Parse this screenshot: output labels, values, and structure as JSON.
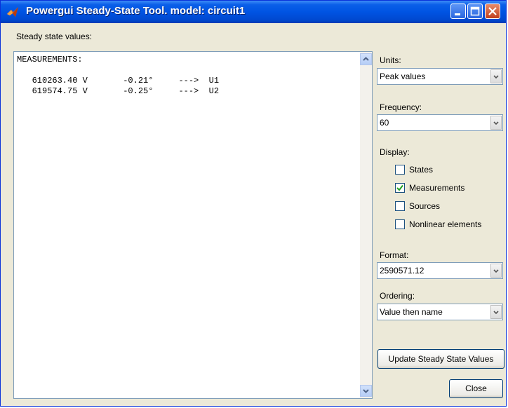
{
  "window": {
    "title": "Powergui Steady-State Tool. model: circuit1"
  },
  "main": {
    "values_label": "Steady state values:",
    "text_lines": [
      "MEASUREMENTS:",
      "",
      "   610263.40 V       -0.21°     --->  U1",
      "   619574.75 V       -0.25°     --->  U2"
    ]
  },
  "panel": {
    "units_label": "Units:",
    "units_value": "Peak values",
    "frequency_label": "Frequency:",
    "frequency_value": "60",
    "display_label": "Display:",
    "display_options": [
      {
        "label": "States",
        "checked": false
      },
      {
        "label": "Measurements",
        "checked": true
      },
      {
        "label": "Sources",
        "checked": false
      },
      {
        "label": "Nonlinear elements",
        "checked": false
      }
    ],
    "format_label": "Format:",
    "format_value": "2590571.12",
    "ordering_label": "Ordering:",
    "ordering_value": "Value then name",
    "update_button": "Update Steady State Values",
    "close_button": "Close"
  },
  "icons": {
    "app": "matlab-logo-icon",
    "minimize": "minimize-icon",
    "maximize": "maximize-icon",
    "close": "close-icon"
  },
  "colors": {
    "titlebar": "#0054e3",
    "window_bg": "#ece9d8",
    "check_green": "#21a121"
  }
}
